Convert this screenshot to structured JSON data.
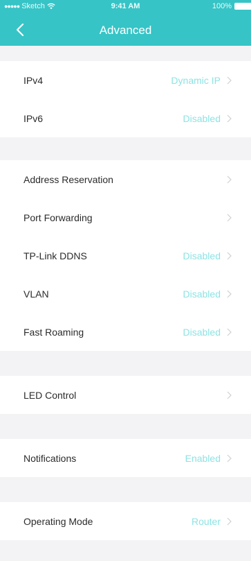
{
  "status_bar": {
    "signal_dots": "●●●●●",
    "carrier": "Sketch",
    "time": "9:41 AM",
    "battery": "100%"
  },
  "nav": {
    "title": "Advanced"
  },
  "colors": {
    "accent": "#36c4c6",
    "value_text": "#8de3e4",
    "label_text": "#2b2b2b",
    "background": "#f3f3f5",
    "chevron": "#d0d0d0"
  },
  "groups": [
    {
      "rows": [
        {
          "label": "IPv4",
          "value": "Dynamic IP"
        },
        {
          "label": "IPv6",
          "value": "Disabled"
        }
      ]
    },
    {
      "rows": [
        {
          "label": "Address Reservation",
          "value": ""
        },
        {
          "label": "Port Forwarding",
          "value": ""
        },
        {
          "label": "TP-Link DDNS",
          "value": "Disabled"
        },
        {
          "label": "VLAN",
          "value": "Disabled"
        },
        {
          "label": "Fast Roaming",
          "value": "Disabled"
        }
      ]
    },
    {
      "rows": [
        {
          "label": "LED Control",
          "value": ""
        }
      ]
    },
    {
      "rows": [
        {
          "label": "Notifications",
          "value": "Enabled"
        }
      ]
    },
    {
      "rows": [
        {
          "label": "Operating Mode",
          "value": "Router"
        }
      ]
    }
  ]
}
